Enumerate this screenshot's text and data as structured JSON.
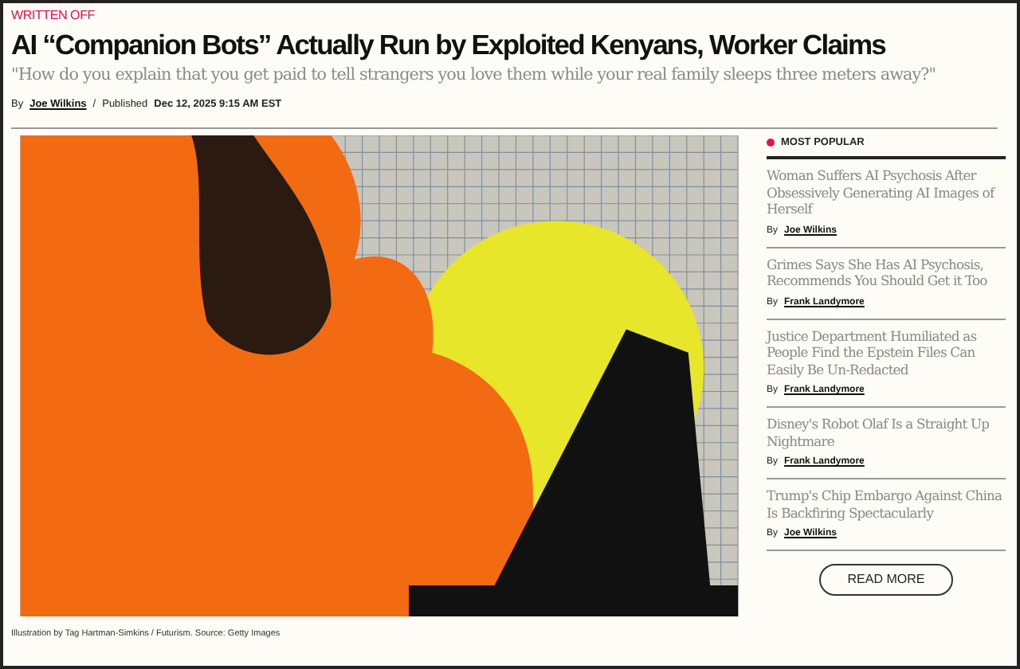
{
  "section_label": "WRITTEN OFF",
  "headline": "AI “Companion Bots” Actually Run by Exploited Kenyans, Worker Claims",
  "deck": "\"How do you explain that you get paid to tell strangers you love them while your real family sleeps three meters away?\"",
  "byline": {
    "by": "By",
    "author": "Joe Wilkins",
    "separator": "/",
    "published_label": "Published",
    "published": "Dec 12, 2025 9:15 AM EST"
  },
  "figure": {
    "caption": "Illustration by Tag Hartman-Simkins / Futurism. Source: Getty Images"
  },
  "most_popular": {
    "title": "MOST POPULAR",
    "articles": [
      {
        "title": "Woman Suffers AI Psychosis After Obsessively Generating AI Images of Herself",
        "by": "By",
        "author": "Joe Wilkins"
      },
      {
        "title": "Grimes Says She Has AI Psychosis, Recommends You Should Get it Too",
        "by": "By",
        "author": "Frank Landymore"
      },
      {
        "title": "Justice Department Humiliated as People Find the Epstein Files Can Easily Be Un-Redacted",
        "by": "By",
        "author": "Frank Landymore"
      },
      {
        "title": "Disney's Robot Olaf Is a Straight Up Nightmare",
        "by": "By",
        "author": "Frank Landymore"
      },
      {
        "title": "Trump's Chip Embargo Against China Is Backfiring Spectacularly",
        "by": "By",
        "author": "Joe Wilkins"
      }
    ],
    "button": "READ MORE"
  }
}
